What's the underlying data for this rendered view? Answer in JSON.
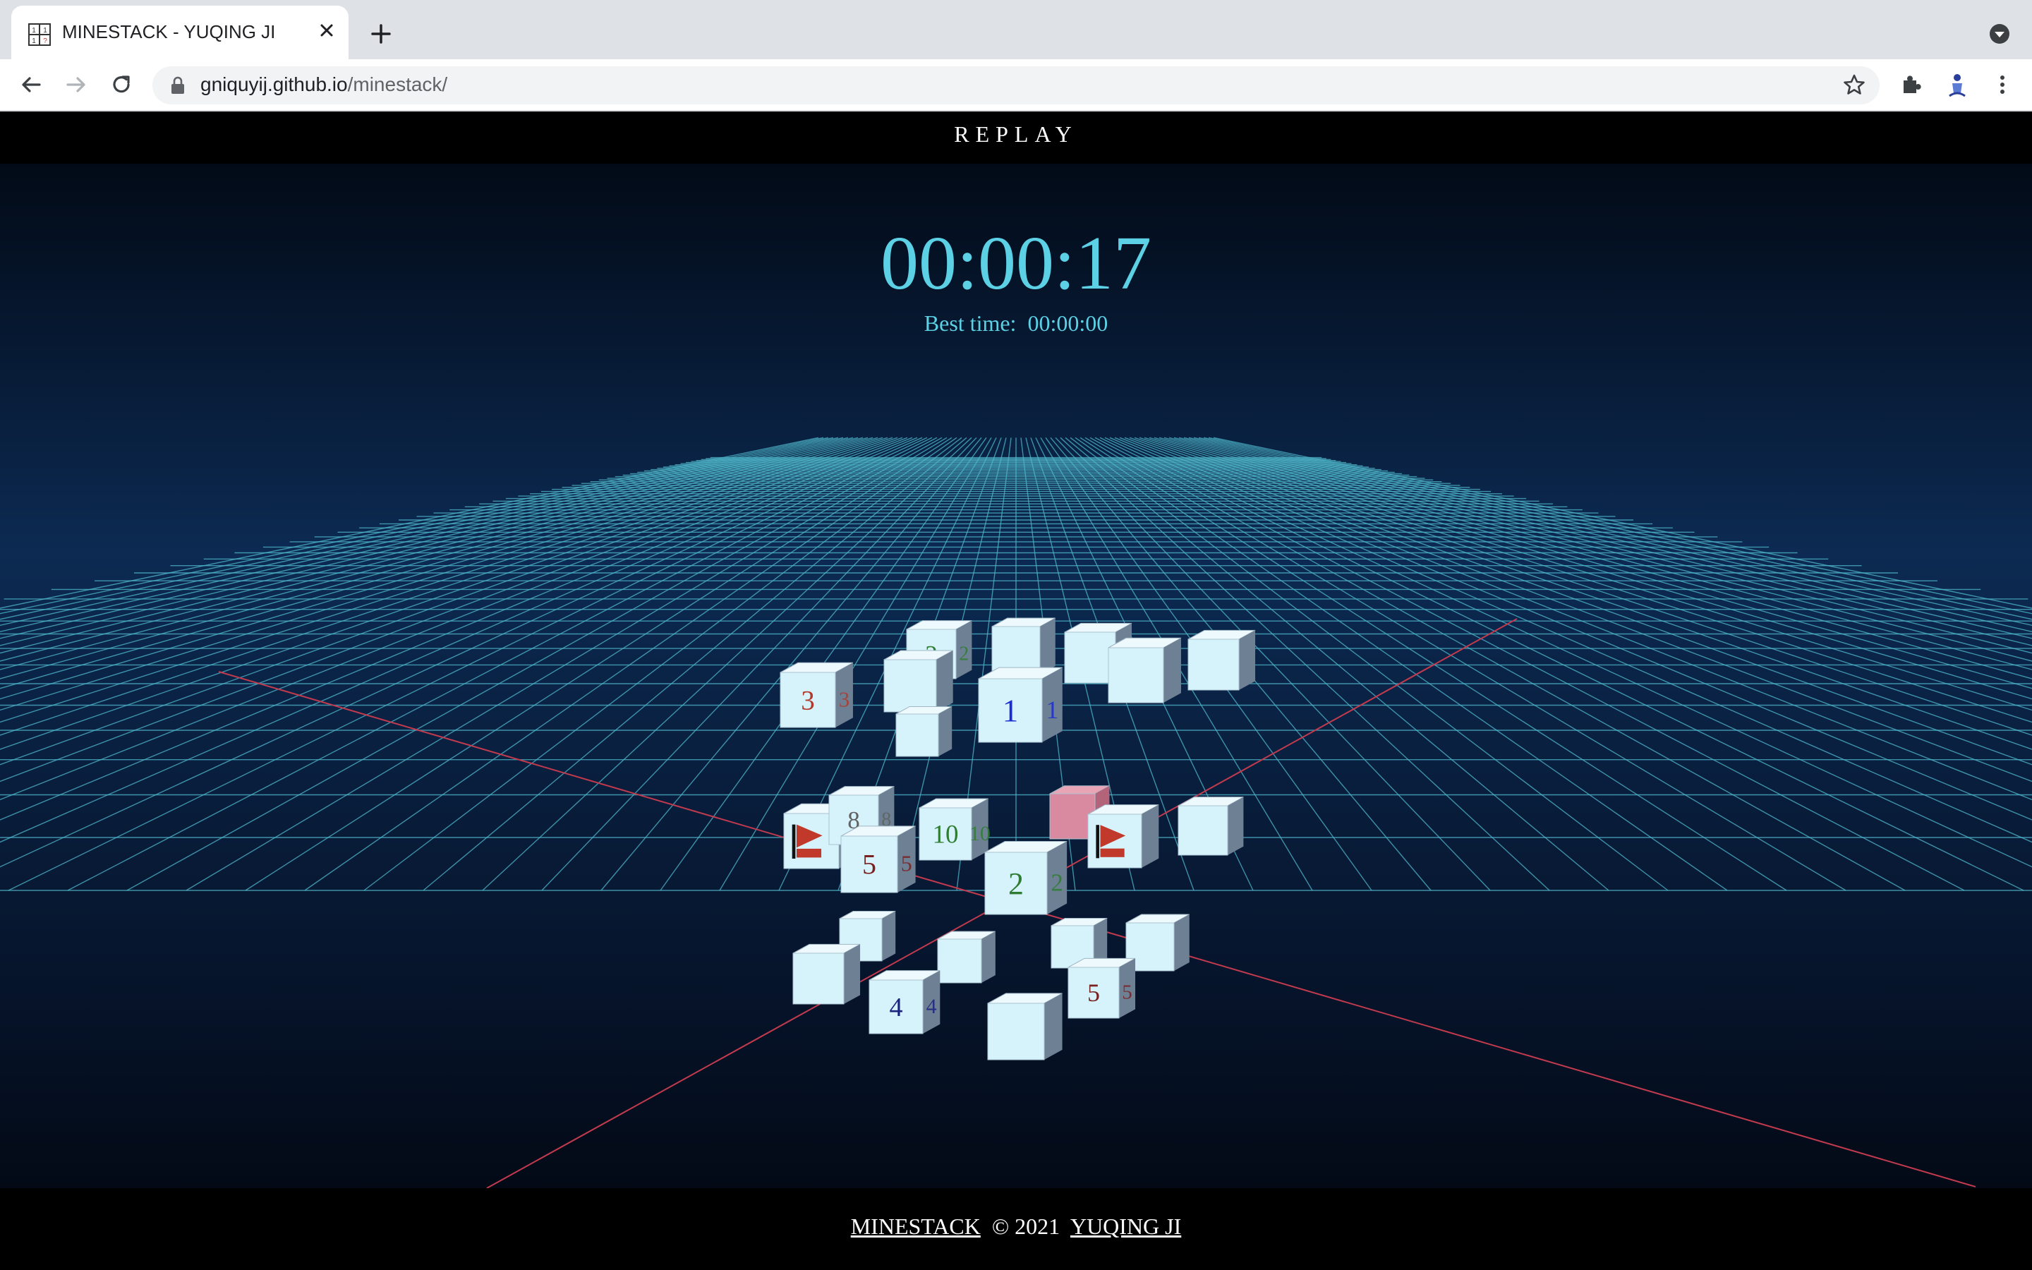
{
  "browser": {
    "tab_title": "MINESTACK - YUQING JI",
    "url_host": "gniquyij.github.io",
    "url_path": "/minestack/"
  },
  "header": {
    "replay_label": "REPLAY"
  },
  "game": {
    "timer": "00:00:17",
    "best_time_label": "Best time:",
    "best_time_value": "00:00:00",
    "cubes": [
      {
        "id": "c1",
        "label": "2",
        "color": "#2e7d32"
      },
      {
        "id": "c2",
        "label": "",
        "color": ""
      },
      {
        "id": "c3",
        "label": "",
        "color": ""
      },
      {
        "id": "c4",
        "label": "",
        "color": ""
      },
      {
        "id": "c5",
        "label": "",
        "color": ""
      },
      {
        "id": "c6",
        "label": "3",
        "color": "#b03a2e"
      },
      {
        "id": "c7",
        "label": "",
        "color": ""
      },
      {
        "id": "c8",
        "label": "1",
        "color": "#1a2bd6"
      },
      {
        "id": "c9",
        "label": "",
        "color": ""
      },
      {
        "id": "c10",
        "label": "flag",
        "color": "#c0392b"
      },
      {
        "id": "c11",
        "label": "8",
        "color": "#616161"
      },
      {
        "id": "c12",
        "label": "10",
        "color": "#2e7d32"
      },
      {
        "id": "c13",
        "label": "",
        "color": "#d98aa0"
      },
      {
        "id": "c14",
        "label": "flag",
        "color": "#c0392b"
      },
      {
        "id": "c15",
        "label": "",
        "color": ""
      },
      {
        "id": "c16",
        "label": "5",
        "color": "#7b1f1f"
      },
      {
        "id": "c17",
        "label": "2",
        "color": "#2e7d32"
      },
      {
        "id": "c18",
        "label": "",
        "color": ""
      },
      {
        "id": "c19",
        "label": "",
        "color": ""
      },
      {
        "id": "c20",
        "label": "",
        "color": ""
      },
      {
        "id": "c21",
        "label": "",
        "color": ""
      },
      {
        "id": "c22",
        "label": "",
        "color": ""
      },
      {
        "id": "c23",
        "label": "4",
        "color": "#1a237e"
      },
      {
        "id": "c24",
        "label": "5",
        "color": "#7b1f1f"
      },
      {
        "id": "c25",
        "label": "",
        "color": ""
      }
    ]
  },
  "footer": {
    "game_link": "MINESTACK",
    "copyright": "  © 2021  ",
    "author_link": "YUQING JI"
  }
}
